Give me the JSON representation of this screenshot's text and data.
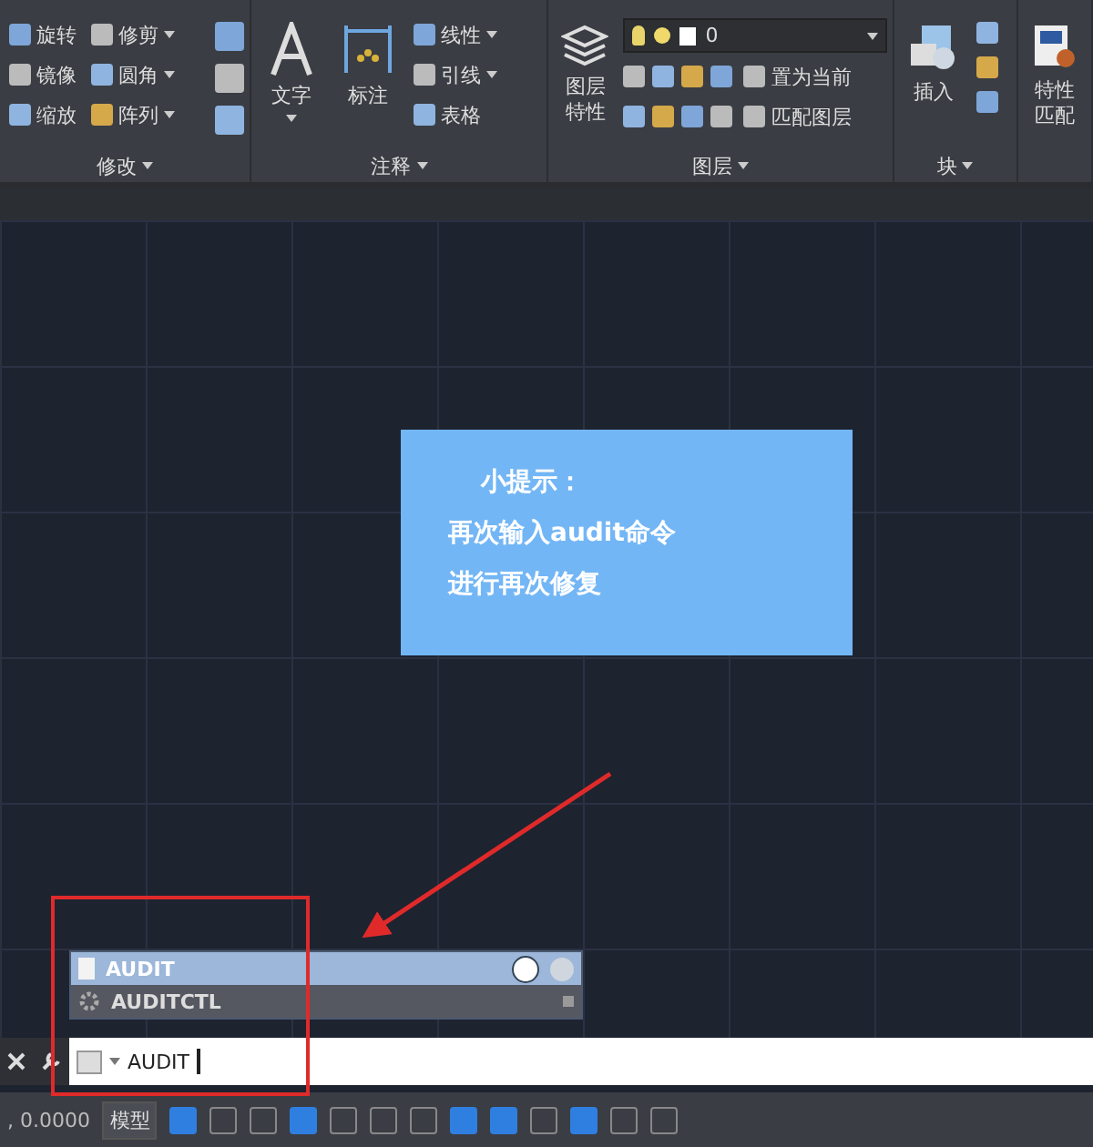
{
  "ribbon": {
    "panels": [
      {
        "title": "修改",
        "kind": "grid",
        "rows": [
          [
            {
              "label": "旋转",
              "dropdown": false
            },
            {
              "label": "修剪",
              "dropdown": true
            }
          ],
          [
            {
              "label": "镜像",
              "dropdown": false
            },
            {
              "label": "圆角",
              "dropdown": true
            }
          ],
          [
            {
              "label": "缩放",
              "dropdown": false
            },
            {
              "label": "阵列",
              "dropdown": true
            }
          ]
        ]
      },
      {
        "title": "注释",
        "kind": "annot",
        "big": [
          {
            "label": "文字",
            "dropdown": true
          },
          {
            "label": "标注",
            "dropdown": false
          }
        ],
        "small": [
          {
            "label": "线性",
            "dropdown": true
          },
          {
            "label": "引线",
            "dropdown": true
          },
          {
            "label": "表格",
            "dropdown": false
          }
        ]
      },
      {
        "title": "图层",
        "kind": "layer",
        "big": [
          {
            "label": "图层特性",
            "dropdown": false
          }
        ],
        "layer_value": "0",
        "small": [
          {
            "label": "置为当前",
            "dropdown": false
          },
          {
            "label": "匹配图层",
            "dropdown": false
          }
        ]
      },
      {
        "title": "块",
        "kind": "block",
        "big": [
          {
            "label": "插入",
            "dropdown": false
          }
        ]
      },
      {
        "kind": "props",
        "big": [
          {
            "label": "特性匹配",
            "dropdown": false
          }
        ]
      }
    ]
  },
  "tip": {
    "title": "小提示：",
    "lines": [
      "再次输入audit命令",
      "进行再次修复"
    ]
  },
  "autocomplete": [
    {
      "label": "AUDIT",
      "selected": true
    },
    {
      "label": "AUDITCTL",
      "selected": false
    }
  ],
  "command": {
    "value": "AUDIT"
  },
  "status_bar": {
    "coordinates": ", 0.0000",
    "space": "模型",
    "toggles": [
      {
        "on": true
      },
      {
        "on": false
      },
      {
        "on": false
      },
      {
        "on": true
      },
      {
        "on": false
      },
      {
        "on": false
      },
      {
        "on": false
      },
      {
        "on": true
      },
      {
        "on": true
      },
      {
        "on": false
      },
      {
        "on": true
      },
      {
        "on": false
      },
      {
        "on": false
      }
    ]
  }
}
